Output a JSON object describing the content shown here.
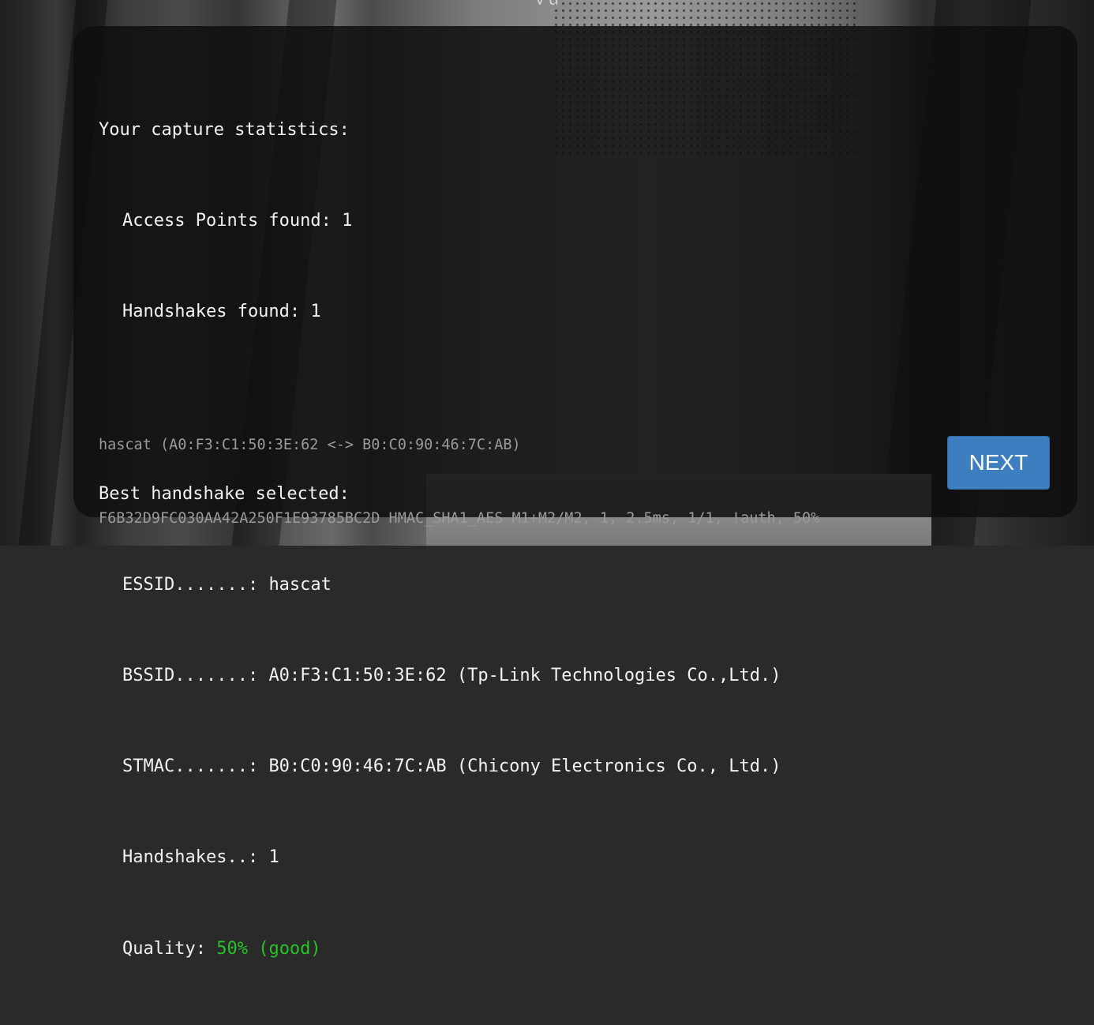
{
  "header": {
    "fragment": "y   g"
  },
  "capture": {
    "title": "Your capture statistics:",
    "access_points_label": "Access Points found: ",
    "access_points_value": "1",
    "handshakes_label": "Handshakes found: ",
    "handshakes_value": "1"
  },
  "best": {
    "title": "Best handshake selected:",
    "essid_label": "ESSID.......: ",
    "essid_value": "hascat",
    "bssid_label": "BSSID.......: ",
    "bssid_value": "A0:F3:C1:50:3E:62 (Tp-Link Technologies Co.,Ltd.)",
    "stmac_label": "STMAC.......: ",
    "stmac_value": "B0:C0:90:46:7C:AB (Chicony Electronics Co., Ltd.)",
    "handshakes_label": "Handshakes..: ",
    "handshakes_value": "1",
    "quality_label": "Quality: ",
    "quality_value": "50% (good)"
  },
  "hash": {
    "line1": "hascat (A0:F3:C1:50:3E:62 <-> B0:C0:90:46:7C:AB)",
    "line2": "F6B32D9FC030AA42A250F1E93785BC2D HMAC_SHA1_AES M1+M2/M2, 1, 2.5ms, 1/1, !auth, 50%"
  },
  "actions": {
    "next_label": "NEXT"
  },
  "colors": {
    "accent": "#3d7ec0",
    "good": "#27c227",
    "panel": "#0e0e0e"
  }
}
